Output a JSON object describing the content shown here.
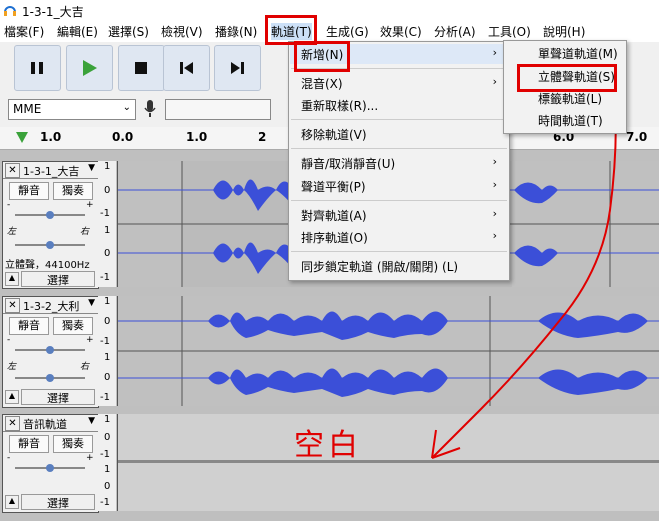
{
  "window": {
    "title": "1-3-1_大吉"
  },
  "menubar": {
    "items": [
      "檔案(F)",
      "編輯(E)",
      "選擇(S)",
      "檢視(V)",
      "播錄(N)",
      "軌道(T)",
      "生成(G)",
      "效果(C)",
      "分析(A)",
      "工具(O)",
      "說明(H)"
    ]
  },
  "devices": {
    "host": "MME"
  },
  "ruler": {
    "ticks": [
      "1.0",
      "0.0",
      "1.0",
      "2",
      "6.0",
      "7.0"
    ]
  },
  "tracks": [
    {
      "name": "1-3-1_大吉",
      "mute": "靜音",
      "solo": "獨奏",
      "left": "左",
      "right": "右",
      "info": "立體聲，44100Hz",
      "select": "選擇",
      "scale": [
        "1",
        "0",
        "-1",
        "1",
        "0",
        "-1"
      ]
    },
    {
      "name": "1-3-2_大利",
      "mute": "靜音",
      "solo": "獨奏",
      "left": "左",
      "right": "右",
      "select": "選擇",
      "scale": [
        "1",
        "0",
        "-1",
        "1",
        "0",
        "-1"
      ]
    },
    {
      "name": "音訊軌道",
      "mute": "靜音",
      "solo": "獨奏",
      "select": "選擇",
      "scale": [
        "1",
        "0",
        "-1",
        "1",
        "0",
        "-1"
      ]
    }
  ],
  "tracks_menu": {
    "items": [
      {
        "label": "新增(N)",
        "submenu": true
      },
      {
        "label": "混音(X)",
        "submenu": true
      },
      {
        "label": "重新取樣(R)...",
        "submenu": false
      },
      {
        "label": "移除軌道(V)",
        "submenu": false
      },
      {
        "label": "靜音/取消靜音(U)",
        "submenu": true
      },
      {
        "label": "聲道平衡(P)",
        "submenu": true
      },
      {
        "label": "對齊軌道(A)",
        "submenu": true
      },
      {
        "label": "排序軌道(O)",
        "submenu": true
      },
      {
        "label": "同步鎖定軌道 (開啟/關閉) (L)",
        "submenu": false
      }
    ]
  },
  "new_submenu": {
    "items": [
      "單聲道軌道(M)",
      "立體聲軌道(S)",
      "標籤軌道(L)",
      "時間軌道(T)"
    ]
  },
  "annotation": {
    "text": "空白"
  },
  "colors": {
    "highlight": "#dde8f7",
    "accent_red": "#e00000",
    "wave": "#3b4fd8"
  }
}
